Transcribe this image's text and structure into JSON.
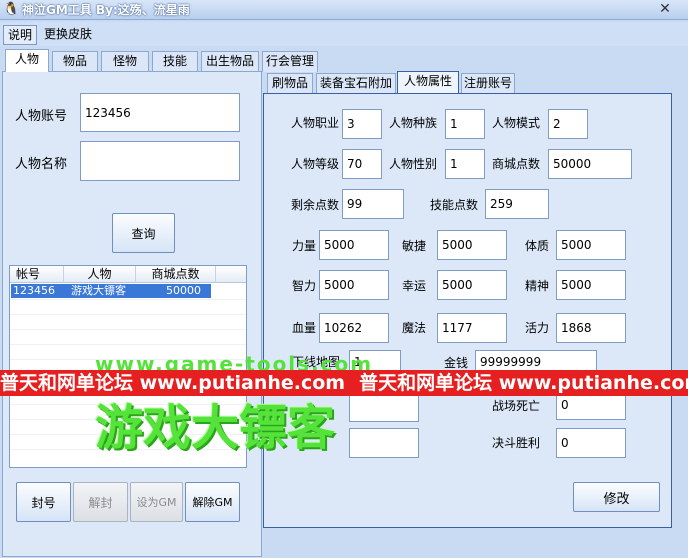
{
  "window": {
    "title": "神泣GM工具    By:这殇、流星雨",
    "close": "✕"
  },
  "menu": {
    "items": [
      "说明",
      "更换皮肤"
    ]
  },
  "main_tabs": [
    "人物",
    "物品",
    "怪物",
    "技能",
    "出生物品",
    "行会管理"
  ],
  "left": {
    "account_label": "人物账号",
    "account_value": "123456",
    "name_label": "人物名称",
    "name_value": "",
    "query_button": "查询",
    "list": {
      "headers": [
        "帐号",
        "人物",
        "商城点数"
      ],
      "rows": [
        {
          "account": "123456",
          "character": "游戏大镖客",
          "points": "50000"
        }
      ]
    },
    "buttons": {
      "ban": "封号",
      "unban": "解封",
      "set_gm": "设为GM",
      "remove_gm": "解除GM"
    }
  },
  "sub_tabs": [
    "刷物品",
    "装备宝石附加",
    "人物属性",
    "注册账号"
  ],
  "attributes": {
    "job_label": "人物职业",
    "job": "3",
    "race_label": "人物种族",
    "race": "1",
    "mode_label": "人物模式",
    "mode": "2",
    "level_label": "人物等级",
    "level": "70",
    "gender_label": "人物性别",
    "gender": "1",
    "mall_label": "商城点数",
    "mall": "50000",
    "rem_label": "剩余点数",
    "rem": "99",
    "skillpts_label": "技能点数",
    "skillpts": "259",
    "str_label": "力量",
    "str": "5000",
    "dex_label": "敏捷",
    "dex": "5000",
    "con_label": "体质",
    "con": "5000",
    "int_label": "智力",
    "int": "5000",
    "luck_label": "幸运",
    "luck": "5000",
    "spirit_label": "精神",
    "spirit": "5000",
    "hp_label": "血量",
    "hp": "10262",
    "mp_label": "魔法",
    "mp": "1177",
    "vigor_label": "活力",
    "vigor": "1868",
    "map_label": "下线地图",
    "map": "1",
    "gold_label": "金钱",
    "gold": "99999999",
    "row7b_value": "",
    "row8b_value": "",
    "deaths_label": "战场死亡",
    "deaths": "0",
    "wins_label": "决斗胜利",
    "wins": "0",
    "modify_button": "修改"
  },
  "watermark": {
    "banner_text": "普天和网单论坛 www.putianhe.com",
    "big_text": "游戏大镖客",
    "tail_text": "www.game-tools.com"
  }
}
